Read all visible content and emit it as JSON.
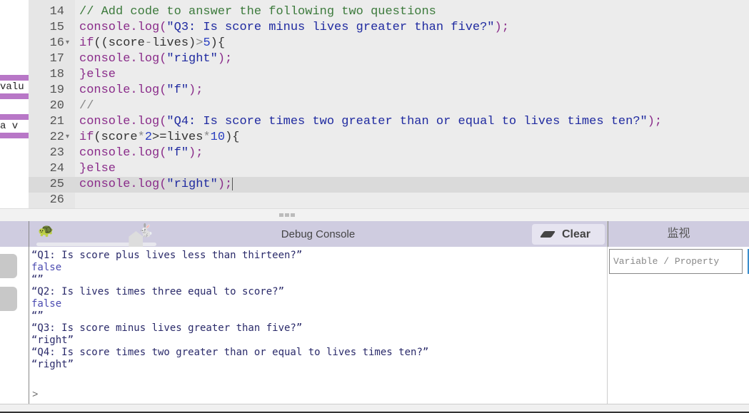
{
  "left_blocks": [
    {
      "text": "valu"
    },
    {
      "text": " a v"
    }
  ],
  "editor": {
    "active_line": 25,
    "lines": [
      {
        "n": "14",
        "fold": "",
        "tokens": [
          [
            "cm",
            "// Add code to answer the following two questions"
          ]
        ]
      },
      {
        "n": "15",
        "fold": "",
        "tokens": [
          [
            "kw",
            "console.log("
          ],
          [
            "str",
            "\"Q3: Is score minus lives greater than five?\""
          ],
          [
            "kw",
            ");"
          ]
        ]
      },
      {
        "n": "16",
        "fold": "▾",
        "tokens": [
          [
            "kw",
            "if"
          ],
          [
            "",
            "((score"
          ],
          [
            "op",
            "-"
          ],
          [
            "",
            "lives)"
          ],
          [
            "op",
            ">"
          ],
          [
            "num",
            "5"
          ],
          [
            "",
            "){"
          ]
        ]
      },
      {
        "n": "17",
        "fold": "",
        "tokens": [
          [
            "kw",
            "console.log("
          ],
          [
            "str",
            "\"right\""
          ],
          [
            "kw",
            ");"
          ]
        ]
      },
      {
        "n": "18",
        "fold": "",
        "tokens": [
          [
            "kw",
            "}else"
          ]
        ]
      },
      {
        "n": "19",
        "fold": "",
        "tokens": [
          [
            "kw",
            "console.log("
          ],
          [
            "str",
            "\"f\""
          ],
          [
            "kw",
            ");"
          ]
        ]
      },
      {
        "n": "20",
        "fold": "",
        "tokens": [
          [
            "op",
            "//"
          ]
        ]
      },
      {
        "n": "21",
        "fold": "",
        "tokens": [
          [
            "kw",
            "console.log("
          ],
          [
            "str",
            "\"Q4: Is score times two greater than or equal to lives times ten?\""
          ],
          [
            "kw",
            ");"
          ]
        ]
      },
      {
        "n": "22",
        "fold": "▾",
        "tokens": [
          [
            "kw",
            "if"
          ],
          [
            "",
            "(score"
          ],
          [
            "op",
            "*"
          ],
          [
            "num",
            "2"
          ],
          [
            "",
            ">=lives"
          ],
          [
            "op",
            "*"
          ],
          [
            "num",
            "10"
          ],
          [
            "",
            "){"
          ]
        ]
      },
      {
        "n": "23",
        "fold": "",
        "tokens": [
          [
            "kw",
            "console.log("
          ],
          [
            "str",
            "\"f\""
          ],
          [
            "kw",
            ");"
          ]
        ]
      },
      {
        "n": "24",
        "fold": "",
        "tokens": [
          [
            "kw",
            "}else"
          ]
        ]
      },
      {
        "n": "25",
        "fold": "",
        "tokens": [
          [
            "kw",
            "console.log("
          ],
          [
            "str",
            "\"right\""
          ],
          [
            "kw",
            ");"
          ]
        ]
      },
      {
        "n": "26",
        "fold": "",
        "tokens": []
      }
    ]
  },
  "console": {
    "title": "Debug Console",
    "clear_label": "Clear",
    "slow_icon": "turtle-icon",
    "fast_icon": "rabbit-icon",
    "speed_percent": 83,
    "output": [
      {
        "t": "“Q1: Is score plus lives less than thirteen?”",
        "c": ""
      },
      {
        "t": "false",
        "c": "b"
      },
      {
        "t": "“”",
        "c": ""
      },
      {
        "t": "“Q2: Is lives times three equal to score?”",
        "c": ""
      },
      {
        "t": "false",
        "c": "b"
      },
      {
        "t": "“”",
        "c": ""
      },
      {
        "t": "“Q3: Is score minus lives greater than five?”",
        "c": ""
      },
      {
        "t": "“right”",
        "c": ""
      },
      {
        "t": "“Q4: Is score times two greater than or equal to lives times ten?”",
        "c": ""
      },
      {
        "t": "“right”",
        "c": ""
      }
    ],
    "prompt": ">"
  },
  "watch": {
    "title": "监视",
    "placeholder": "Variable / Property",
    "value": ""
  },
  "colors": {
    "header": "#cfcce0",
    "block": "#b877c7",
    "accent": "#3a8ccc"
  }
}
